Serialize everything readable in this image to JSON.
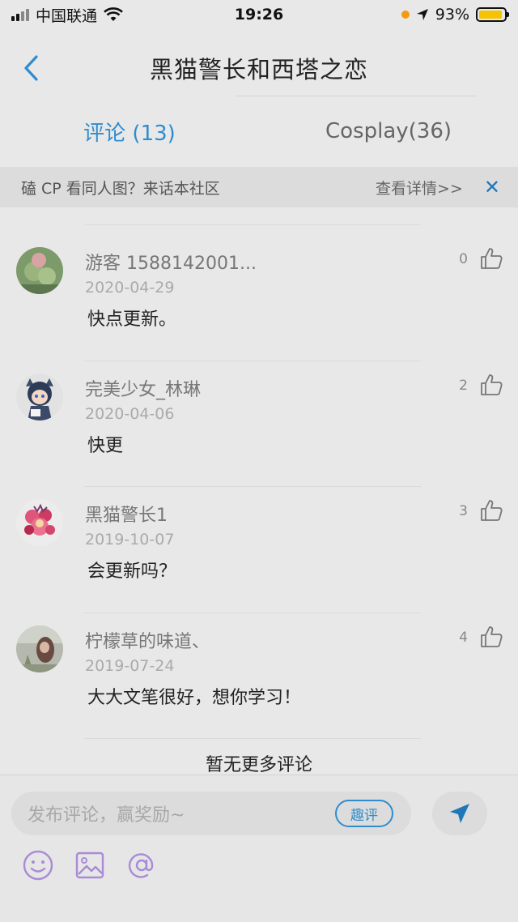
{
  "status_bar": {
    "carrier": "中国联通",
    "time": "19:26",
    "battery_percent": "93%",
    "battery_level": 0.93
  },
  "nav": {
    "title": "黑猫警长和西塔之恋"
  },
  "tabs": [
    {
      "label": "评论 (13)",
      "active": true
    },
    {
      "label": "Cosplay(36)",
      "active": false
    }
  ],
  "notice": {
    "text": "磕 CP 看同人图？来话本社区",
    "link": "查看详情>>",
    "close": "✕"
  },
  "comments": [
    {
      "name": "游客 1588142001...",
      "date": "2020-04-29",
      "text": "快点更新。",
      "likes": "0"
    },
    {
      "name": "完美少女_林琳",
      "date": "2020-04-06",
      "text": "快更",
      "likes": "2"
    },
    {
      "name": "黑猫警长1",
      "date": "2019-10-07",
      "text": "会更新吗？",
      "likes": "3"
    },
    {
      "name": "柠檬草的味道、",
      "date": "2019-07-24",
      "text": "大大文笔很好，想你学习！",
      "likes": "4"
    }
  ],
  "no_more": "暂无更多评论",
  "composer": {
    "placeholder": "发布评论，赢奖励~",
    "fun_review": "趣评"
  },
  "colors": {
    "accent": "#2f8ccf",
    "background": "#e8e8e8"
  },
  "icons": [
    "back-chevron-icon",
    "thumbs-up-icon",
    "send-icon",
    "emoji-icon",
    "image-icon",
    "at-icon"
  ]
}
